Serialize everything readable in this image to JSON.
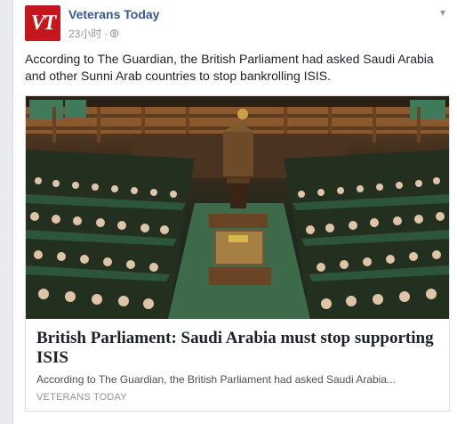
{
  "post": {
    "page_name": "Veterans Today",
    "avatar_text": "VT",
    "timestamp": "23小时",
    "separator": "·",
    "audience_icon": "globe-icon",
    "menu_icon": "chevron-down-icon",
    "message": "According to The Guardian, the British Parliament had asked Saudi Arabia and other Sunni Arab countries to stop bankrolling ISIS."
  },
  "link_card": {
    "title": "British Parliament: Saudi Arabia must stop supporting ISIS",
    "description": "According to The Guardian, the British Parliament had asked Saudi Arabia...",
    "source": "VETERANS TODAY"
  },
  "colors": {
    "brand_red": "#c4161c",
    "link_blue": "#365899",
    "meta_gray": "#90949c",
    "bg": "#e9ebee"
  }
}
